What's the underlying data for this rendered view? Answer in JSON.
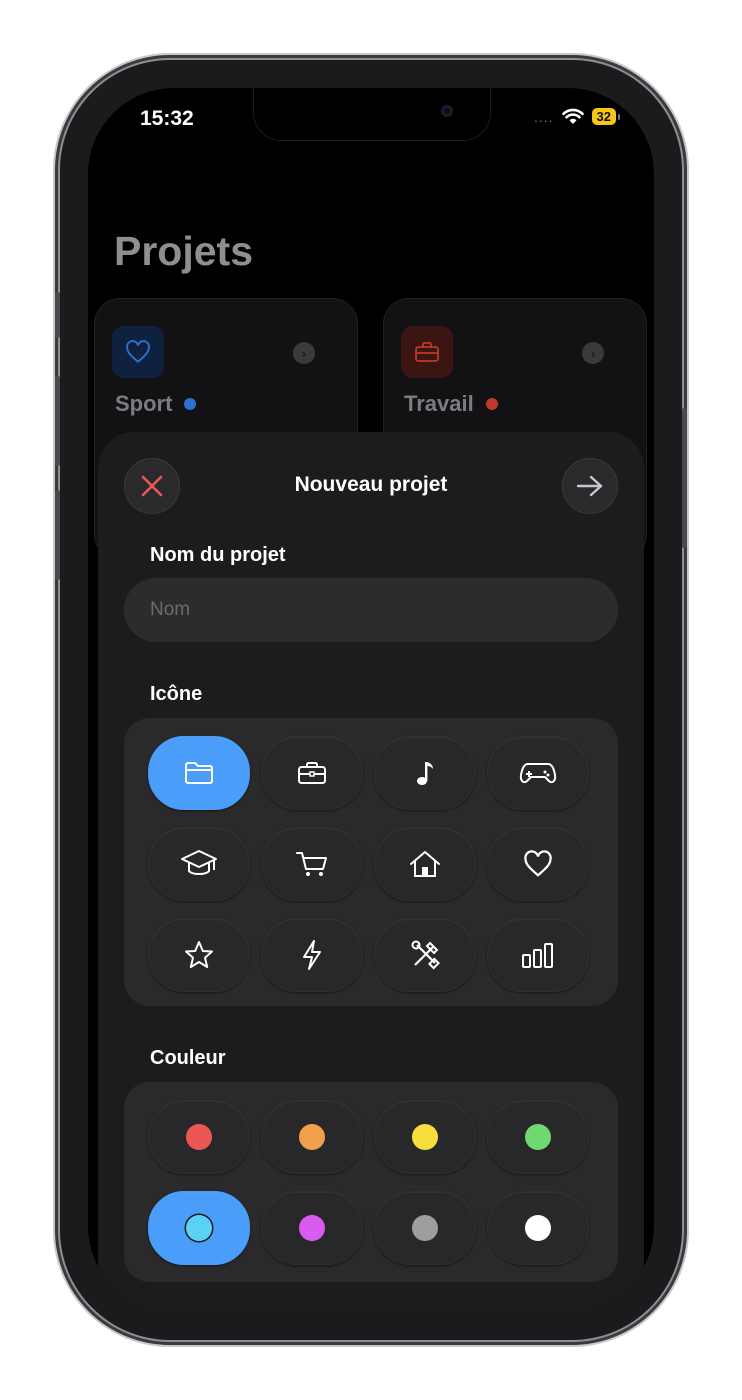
{
  "status": {
    "time": "15:32",
    "signal_dots": "....",
    "battery": "32"
  },
  "page": {
    "title": "Projets"
  },
  "cards": [
    {
      "name": "Sport",
      "icon": "heart-icon",
      "color": "#2f6fd0"
    },
    {
      "name": "Travail",
      "icon": "briefcase-icon",
      "color": "#c0392b"
    }
  ],
  "sheet": {
    "title": "Nouveau projet",
    "name_label": "Nom du projet",
    "name_placeholder": "Nom",
    "name_value": "",
    "icon_label": "Icône",
    "color_label": "Couleur",
    "icons": [
      "folder-icon",
      "briefcase-icon",
      "music-note-icon",
      "gamepad-icon",
      "graduation-cap-icon",
      "cart-icon",
      "house-icon",
      "heart-icon",
      "star-icon",
      "bolt-icon",
      "tools-icon",
      "chart-bars-icon"
    ],
    "selected_icon": "folder-icon",
    "colors": [
      "#eb5757",
      "#f2a04e",
      "#f7de3a",
      "#6fd86f",
      "#5bd2f5",
      "#d95cf0",
      "#9e9e9e",
      "#ffffff"
    ],
    "selected_color": "#5bd2f5",
    "accent": "#4a9df8"
  }
}
